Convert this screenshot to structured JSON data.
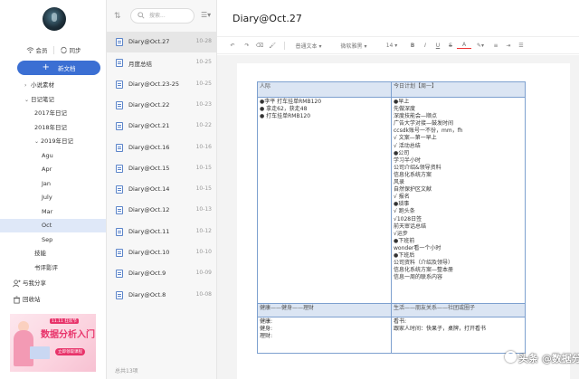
{
  "sidebar": {
    "account": {
      "member_label": "会员",
      "sync_label": "同步"
    },
    "new_doc_label": "新文档",
    "tree": [
      {
        "label": "小说素材",
        "arrow": "›",
        "indent": 1
      },
      {
        "label": "日记笔记",
        "arrow": "⌄",
        "indent": 1
      },
      {
        "label": "2017年日记",
        "arrow": "",
        "indent": 2
      },
      {
        "label": "2018年日记",
        "arrow": "",
        "indent": 2
      },
      {
        "label": "2019年日记",
        "arrow": "⌄",
        "indent": 2
      },
      {
        "label": "Agu",
        "arrow": "",
        "indent": 3
      },
      {
        "label": "Apr",
        "arrow": "",
        "indent": 3
      },
      {
        "label": "Jan",
        "arrow": "",
        "indent": 3
      },
      {
        "label": "July",
        "arrow": "",
        "indent": 3
      },
      {
        "label": "Mar",
        "arrow": "",
        "indent": 3
      },
      {
        "label": "Oct",
        "arrow": "",
        "indent": 3
      },
      {
        "label": "Sep",
        "arrow": "",
        "indent": 3
      },
      {
        "label": "技能",
        "arrow": "",
        "indent": 2
      },
      {
        "label": "书评影评",
        "arrow": "",
        "indent": 2
      }
    ],
    "selected_item": "Oct",
    "share_label": "与我分享",
    "trash_label": "回收站",
    "ad": {
      "tag": "11.11 狂欢节",
      "title": "数据分析入门",
      "button": "立即领取课程"
    }
  },
  "doclist": {
    "search_placeholder": "搜索...",
    "items": [
      {
        "title": "Diary@Oct.27",
        "date": "10-28"
      },
      {
        "title": "月度总结",
        "date": "10-25"
      },
      {
        "title": "Diary@Oct.23-25",
        "date": "10-25"
      },
      {
        "title": "Diary@Oct.22",
        "date": "10-23"
      },
      {
        "title": "Diary@Oct.21",
        "date": "10-22"
      },
      {
        "title": "Diary@Oct.16",
        "date": "10-16"
      },
      {
        "title": "Diary@Oct.15",
        "date": "10-15"
      },
      {
        "title": "Diary@Oct.14",
        "date": "10-15"
      },
      {
        "title": "Diary@Oct.12",
        "date": "10-13"
      },
      {
        "title": "Diary@Oct.11",
        "date": "10-12"
      },
      {
        "title": "Diary@Oct.10",
        "date": "10-10"
      },
      {
        "title": "Diary@Oct.9",
        "date": "10-09"
      },
      {
        "title": "Diary@Oct.8",
        "date": "10-08"
      }
    ],
    "count_label": "总共13项"
  },
  "editor": {
    "title": "Diary@Oct.27",
    "toolbar": {
      "style_label": "普通文本",
      "font_label": "微软雅黑",
      "size_label": "14"
    },
    "table": {
      "col1_header": "人际",
      "col2_header": "今日计划【周一】",
      "col1_lines": [
        "●李平 打车挂单RMB120",
        "● 拿走62，获走48",
        "● 打车挂单RMB120"
      ],
      "col2_lines": [
        "●早上",
        "先做深度",
        "深度技能会—顺点",
        "广告大学对接—鼓发时间",
        "ccsdk账号一不份，mm，fh",
        "√ 文案—第一早上",
        "√ 活动总结",
        "●公司",
        "学习半小时",
        "公司介绍&领导资料",
        "信息化系统方案",
        "风录",
        "自然保护区文献",
        "√ 报名",
        "●琐事",
        "√ 跑头条",
        "√1028日签",
        "前天审话总结",
        "√运步",
        "●下班前",
        "wonder看一个小时",
        "●下班后",
        "公司资料（介绍及领导）",
        "信息化系统方案—整本册",
        "信息一周的联系内容"
      ],
      "mid_col1": "健康——健身——理财",
      "mid_col2": "生活——朋友关系——社团或圈子",
      "foot_col1_lines": [
        "健康:",
        "健身:",
        "理财:"
      ],
      "foot_col2_lines": [
        "看书:",
        "跟家人时间：快果子，桌牌，打开看书"
      ]
    }
  },
  "watermark": "头条 @数据分析小白"
}
